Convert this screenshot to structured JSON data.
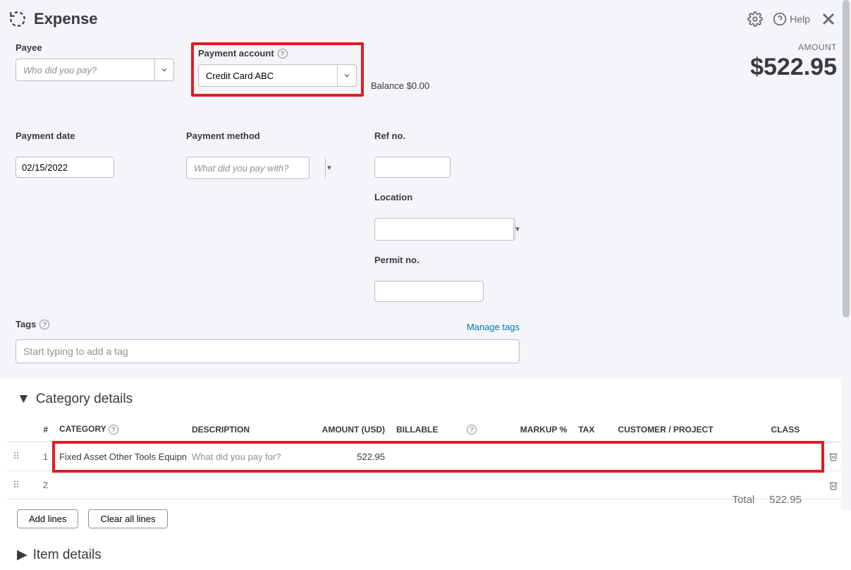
{
  "header": {
    "title": "Expense",
    "help_label": "Help"
  },
  "payee": {
    "label": "Payee",
    "placeholder": "Who did you pay?"
  },
  "payment_account": {
    "label": "Payment account",
    "value": "Credit Card ABC"
  },
  "balance": {
    "label": "Balance",
    "value": "$0.00"
  },
  "amount": {
    "label": "AMOUNT",
    "value": "$522.95"
  },
  "payment_date": {
    "label": "Payment date",
    "value": "02/15/2022"
  },
  "payment_method": {
    "label": "Payment method",
    "placeholder": "What did you pay with?"
  },
  "ref_no": {
    "label": "Ref no."
  },
  "location": {
    "label": "Location"
  },
  "permit_no": {
    "label": "Permit no."
  },
  "tags": {
    "label": "Tags",
    "placeholder": "Start typing to add a tag",
    "manage": "Manage tags"
  },
  "category_details": {
    "title": "Category details",
    "columns": {
      "num": "#",
      "category": "CATEGORY",
      "description": "DESCRIPTION",
      "amount": "AMOUNT (USD)",
      "billable": "BILLABLE",
      "markup": "MARKUP %",
      "tax": "TAX",
      "customer": "CUSTOMER / PROJECT",
      "class": "CLASS"
    },
    "rows": [
      {
        "num": "1",
        "category": "Fixed Asset Other Tools Equipme",
        "description_placeholder": "What did you pay for?",
        "amount": "522.95"
      },
      {
        "num": "2",
        "category": "",
        "description_placeholder": "",
        "amount": ""
      }
    ],
    "add_lines": "Add lines",
    "clear_lines": "Clear all lines"
  },
  "item_details": {
    "title": "Item details"
  },
  "total": {
    "label": "Total",
    "value": "522.95"
  }
}
